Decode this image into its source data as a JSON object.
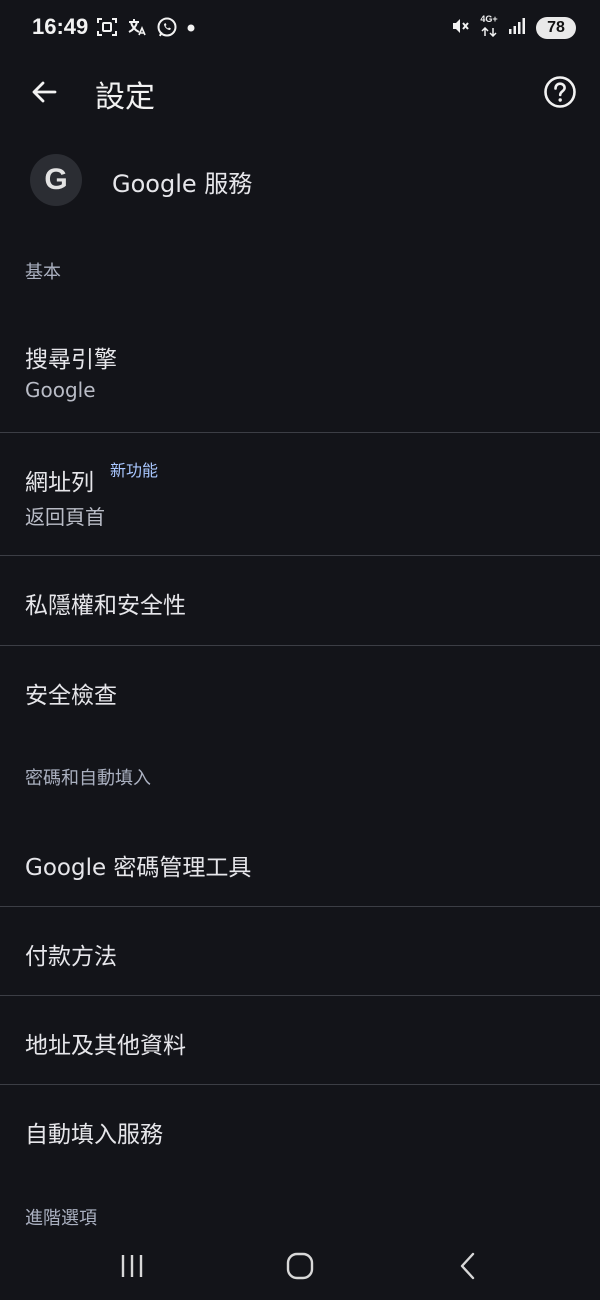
{
  "status_bar": {
    "time": "16:49",
    "left_icons": [
      "screenshot-icon",
      "translate-icon",
      "whatsapp-icon",
      "notification-dot-icon"
    ],
    "right_icons": [
      "mute-icon",
      "network-4g-icon",
      "signal-icon"
    ],
    "network_label": "4G+",
    "battery": "78"
  },
  "app_bar": {
    "title": "設定",
    "back_icon": "arrow-left-icon",
    "help_icon": "help-circle-icon"
  },
  "google_services": {
    "avatar_letter": "G",
    "label": "Google 服務"
  },
  "sections": {
    "basic": "基本",
    "passwords": "密碼和自動填入",
    "advanced": "進階選項"
  },
  "rows": {
    "search_engine": {
      "title": "搜尋引擎",
      "subtitle": "Google"
    },
    "address_bar": {
      "title": "網址列",
      "badge": "新功能",
      "subtitle": "返回頁首"
    },
    "privacy": {
      "title": "私隱權和安全性"
    },
    "safety_check": {
      "title": "安全檢查"
    },
    "password_manager": {
      "title": "Google 密碼管理工具"
    },
    "payment": {
      "title": "付款方法"
    },
    "addresses": {
      "title": "地址及其他資料"
    },
    "autofill_services": {
      "title": "自動填入服務"
    }
  },
  "nav_bar": {
    "items": [
      "recents-icon",
      "home-icon",
      "back-icon"
    ]
  },
  "colors": {
    "background": "#131419",
    "text": "#e6e6ea",
    "section": "#aab0c0",
    "badge": "#a9c7ff",
    "divider": "#3c3e45"
  }
}
